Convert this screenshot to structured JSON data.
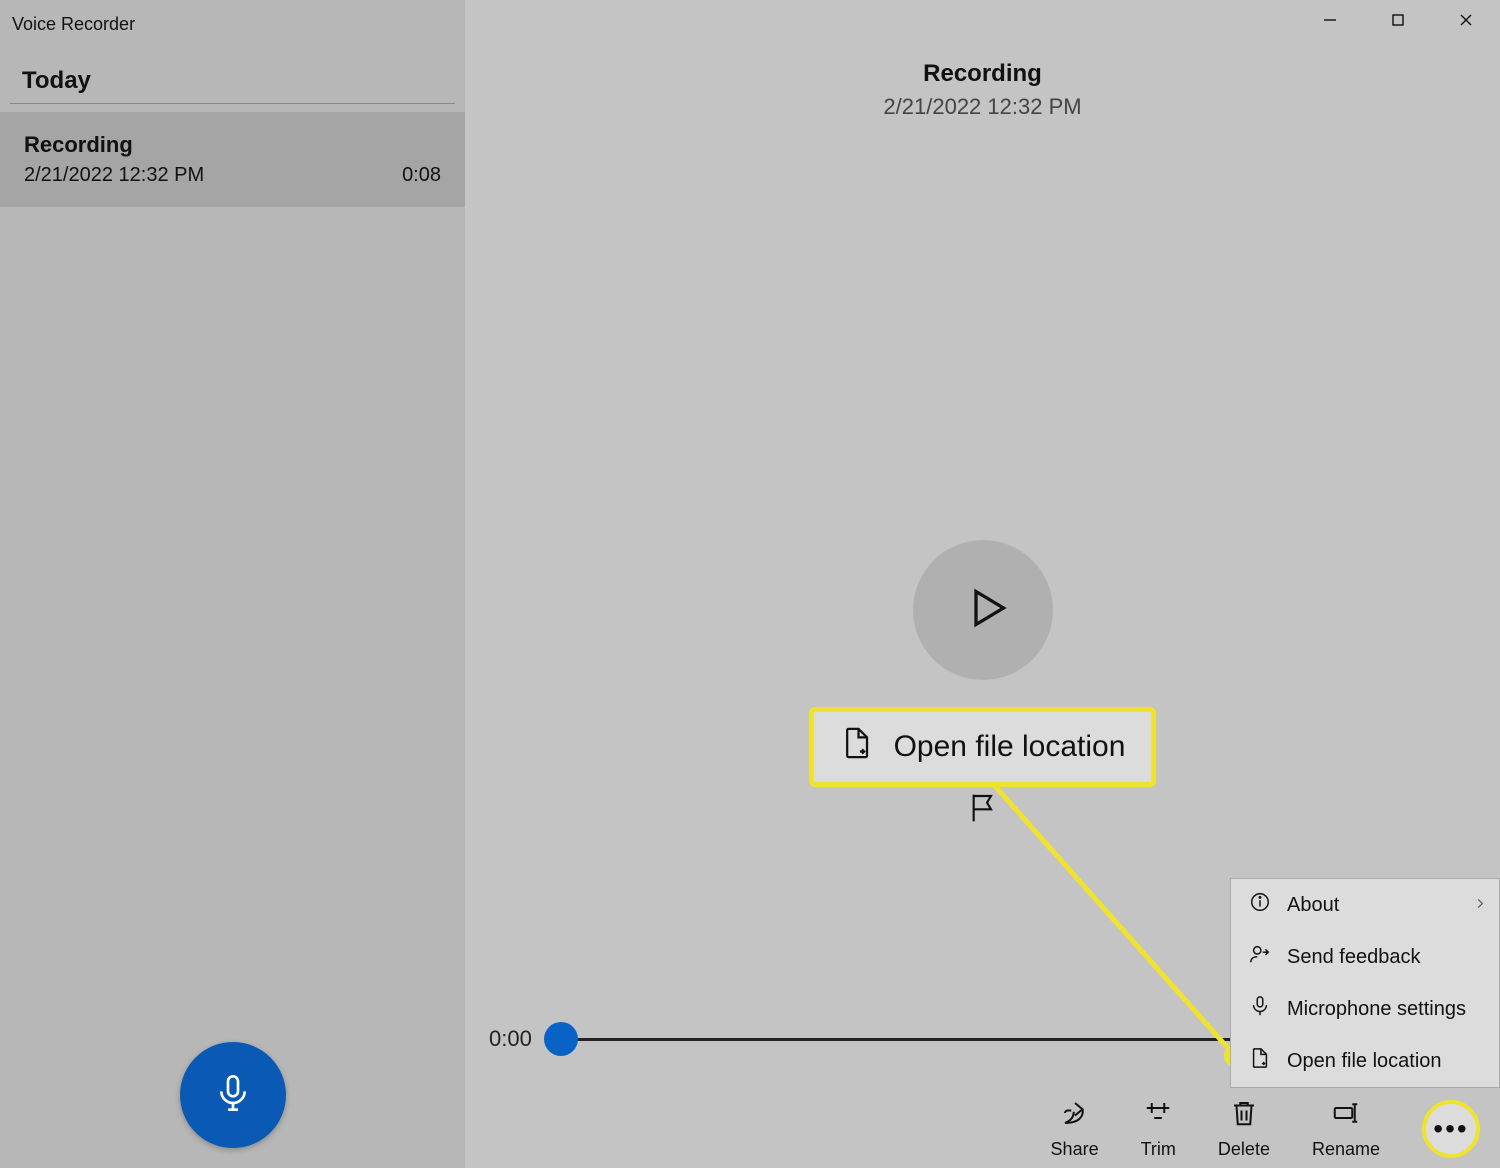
{
  "app": {
    "title": "Voice Recorder"
  },
  "sidebar": {
    "section_label": "Today",
    "items": [
      {
        "title": "Recording",
        "datetime": "2/21/2022 12:32 PM",
        "duration": "0:08"
      }
    ]
  },
  "header": {
    "title": "Recording",
    "subtitle": "2/21/2022 12:32 PM"
  },
  "playback": {
    "current_time": "0:00"
  },
  "callout": {
    "label": "Open file location"
  },
  "toolbar": {
    "share": "Share",
    "trim": "Trim",
    "delete": "Delete",
    "rename": "Rename"
  },
  "menu": {
    "about": "About",
    "feedback": "Send feedback",
    "mic": "Microphone settings",
    "open_loc": "Open file location"
  }
}
